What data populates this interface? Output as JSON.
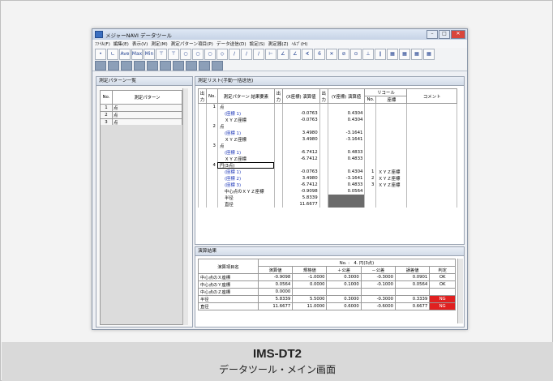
{
  "window": {
    "title": "メジャーNAVI データツール",
    "menu": [
      "ﾌｧｲﾙ(F)",
      "編集(E)",
      "表示(V)",
      "測定(M)",
      "測定パターン項目(P)",
      "データ送信(D)",
      "設定(S)",
      "測定器(Z)",
      "ﾍﾙﾌﾟ(H)"
    ],
    "toolbar1": [
      "•",
      "∟",
      "Ave",
      "Max",
      "Min",
      "⊤",
      "⊤",
      "○",
      "○",
      "○",
      "◇",
      "∕",
      "∕",
      "∕",
      "⊢",
      "∠",
      "∠",
      "∢",
      "6",
      "✕",
      "⊘",
      "⊙",
      "⊥",
      "∥",
      "▦",
      "▦",
      "▦",
      "▦"
    ],
    "toolbar2_count": 10
  },
  "left_panel": {
    "title": "測定パターン一覧",
    "headers": [
      "No.",
      "測定パターン"
    ],
    "rows": [
      {
        "no": "1",
        "name": "点"
      },
      {
        "no": "2",
        "name": "点"
      },
      {
        "no": "3",
        "name": "点"
      },
      {
        "no": "4",
        "name": "円(3点)"
      }
    ]
  },
  "right_panel": {
    "title": "測定リスト(手動一括送信)",
    "headers": {
      "out1": "出力",
      "no": "No.",
      "pattern": "測定パターン 結果要素",
      "out2": "出力",
      "x": "(X座標) 演算値",
      "out3": "出力",
      "y": "(Y座標) 演算値",
      "recall": "リコール",
      "recall_no": "No.",
      "recall_coord": "座標",
      "comment": "コメント"
    },
    "rows": [
      {
        "no": "1",
        "name": "点",
        "x": "",
        "y": "",
        "rno": "",
        "rc": "",
        "type": "head"
      },
      {
        "no": "",
        "name": "(座標 1)",
        "x": "-0.0763",
        "y": "0.4304",
        "rno": "",
        "rc": "",
        "type": "blue"
      },
      {
        "no": "",
        "name": "ＸＹＺ座標",
        "x": "-0.0763",
        "y": "0.4304",
        "rno": "",
        "rc": "",
        "type": "sub"
      },
      {
        "no": "2",
        "name": "点",
        "x": "",
        "y": "",
        "rno": "",
        "rc": "",
        "type": "head"
      },
      {
        "no": "",
        "name": "(座標 1)",
        "x": "3.4980",
        "y": "-3.1641",
        "rno": "",
        "rc": "",
        "type": "blue"
      },
      {
        "no": "",
        "name": "ＸＹＺ座標",
        "x": "3.4980",
        "y": "-3.1641",
        "rno": "",
        "rc": "",
        "type": "sub"
      },
      {
        "no": "3",
        "name": "点",
        "x": "",
        "y": "",
        "rno": "",
        "rc": "",
        "type": "head"
      },
      {
        "no": "",
        "name": "(座標 1)",
        "x": "-6.7412",
        "y": "0.4833",
        "rno": "",
        "rc": "",
        "type": "blue"
      },
      {
        "no": "",
        "name": "ＸＹＺ座標",
        "x": "-6.7412",
        "y": "0.4833",
        "rno": "",
        "rc": "",
        "type": "sub"
      },
      {
        "no": "4",
        "name": "円(3点)",
        "x": "",
        "y": "",
        "rno": "",
        "rc": "",
        "type": "head-sel"
      },
      {
        "no": "",
        "name": "(座標 1)",
        "x": "-0.0763",
        "y": "0.4304",
        "rno": "1",
        "rc": "ＸＹＺ座標",
        "type": "blue"
      },
      {
        "no": "",
        "name": "(座標 2)",
        "x": "3.4980",
        "y": "-3.1641",
        "rno": "2",
        "rc": "ＸＹＺ座標",
        "type": "blue"
      },
      {
        "no": "",
        "name": "(座標 3)",
        "x": "-6.7412",
        "y": "0.4833",
        "rno": "3",
        "rc": "ＸＹＺ座標",
        "type": "blue"
      },
      {
        "no": "",
        "name": "中心点のＸＹＺ座標",
        "x": "-0.9098",
        "y": "0.0564",
        "rno": "",
        "rc": "",
        "type": "sub"
      },
      {
        "no": "",
        "name": "半径",
        "x": "5.8339",
        "y": "",
        "rno": "",
        "rc": "",
        "type": "sub-grey"
      },
      {
        "no": "",
        "name": "直径",
        "x": "11.6677",
        "y": "",
        "rno": "",
        "rc": "",
        "type": "sub-grey"
      }
    ]
  },
  "bottom_panel": {
    "title": "演算結果",
    "item_header": "演算項目名",
    "group_header": "No. :　4. 円(3点)",
    "col_headers": [
      "演算値",
      "規格値",
      "＋公差",
      "－公差",
      "誤差値",
      "判定"
    ],
    "rows": [
      {
        "name": "中心点のＸ座標",
        "vals": [
          "-0.9098",
          "-1.0000",
          "0.3000",
          "-0.3000",
          "0.0901"
        ],
        "judge": "OK"
      },
      {
        "name": "中心点のＹ座標",
        "vals": [
          "0.0564",
          "0.0000",
          "0.1000",
          "-0.1000",
          "0.0564"
        ],
        "judge": "OK"
      },
      {
        "name": "中心点のＺ座標",
        "vals": [
          "0.0000",
          "",
          "",
          "",
          ""
        ],
        "judge": ""
      },
      {
        "name": "半径",
        "vals": [
          "5.8339",
          "5.5000",
          "0.3000",
          "-0.3000",
          "0.3339"
        ],
        "judge": "NG"
      },
      {
        "name": "直径",
        "vals": [
          "11.6677",
          "11.0000",
          "0.6000",
          "-0.6000",
          "0.6677"
        ],
        "judge": "NG"
      }
    ]
  },
  "caption": {
    "title": "IMS-DT2",
    "subtitle": "データツール・メイン画面"
  }
}
